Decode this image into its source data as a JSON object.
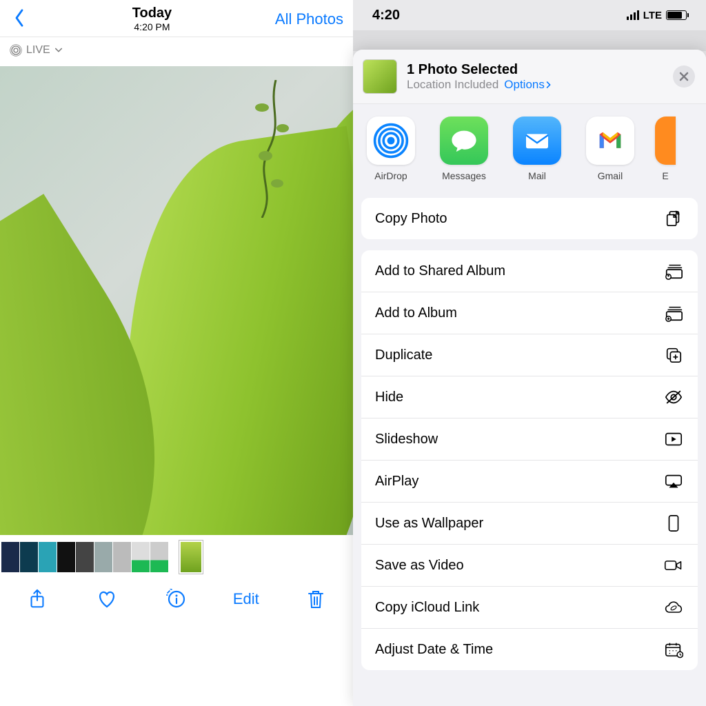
{
  "left": {
    "header": {
      "title": "Today",
      "time": "4:20 PM",
      "all_photos": "All Photos"
    },
    "live_badge": "LIVE",
    "toolbar": {
      "edit": "Edit"
    }
  },
  "right": {
    "status": {
      "time": "4:20",
      "network": "LTE"
    },
    "sheet_header": {
      "title": "1 Photo Selected",
      "subtitle": "Location Included",
      "options": "Options"
    },
    "apps": [
      {
        "label": "AirDrop"
      },
      {
        "label": "Messages"
      },
      {
        "label": "Mail"
      },
      {
        "label": "Gmail"
      },
      {
        "label": "E"
      }
    ],
    "actions_group1": [
      {
        "label": "Copy Photo",
        "icon": "copy"
      }
    ],
    "actions_group2": [
      {
        "label": "Add to Shared Album",
        "icon": "shared-album"
      },
      {
        "label": "Add to Album",
        "icon": "add-album"
      },
      {
        "label": "Duplicate",
        "icon": "duplicate"
      },
      {
        "label": "Hide",
        "icon": "hide"
      },
      {
        "label": "Slideshow",
        "icon": "slideshow"
      },
      {
        "label": "AirPlay",
        "icon": "airplay"
      },
      {
        "label": "Use as Wallpaper",
        "icon": "wallpaper"
      },
      {
        "label": "Save as Video",
        "icon": "video"
      },
      {
        "label": "Copy iCloud Link",
        "icon": "icloud"
      },
      {
        "label": "Adjust Date & Time",
        "icon": "calendar"
      }
    ]
  }
}
